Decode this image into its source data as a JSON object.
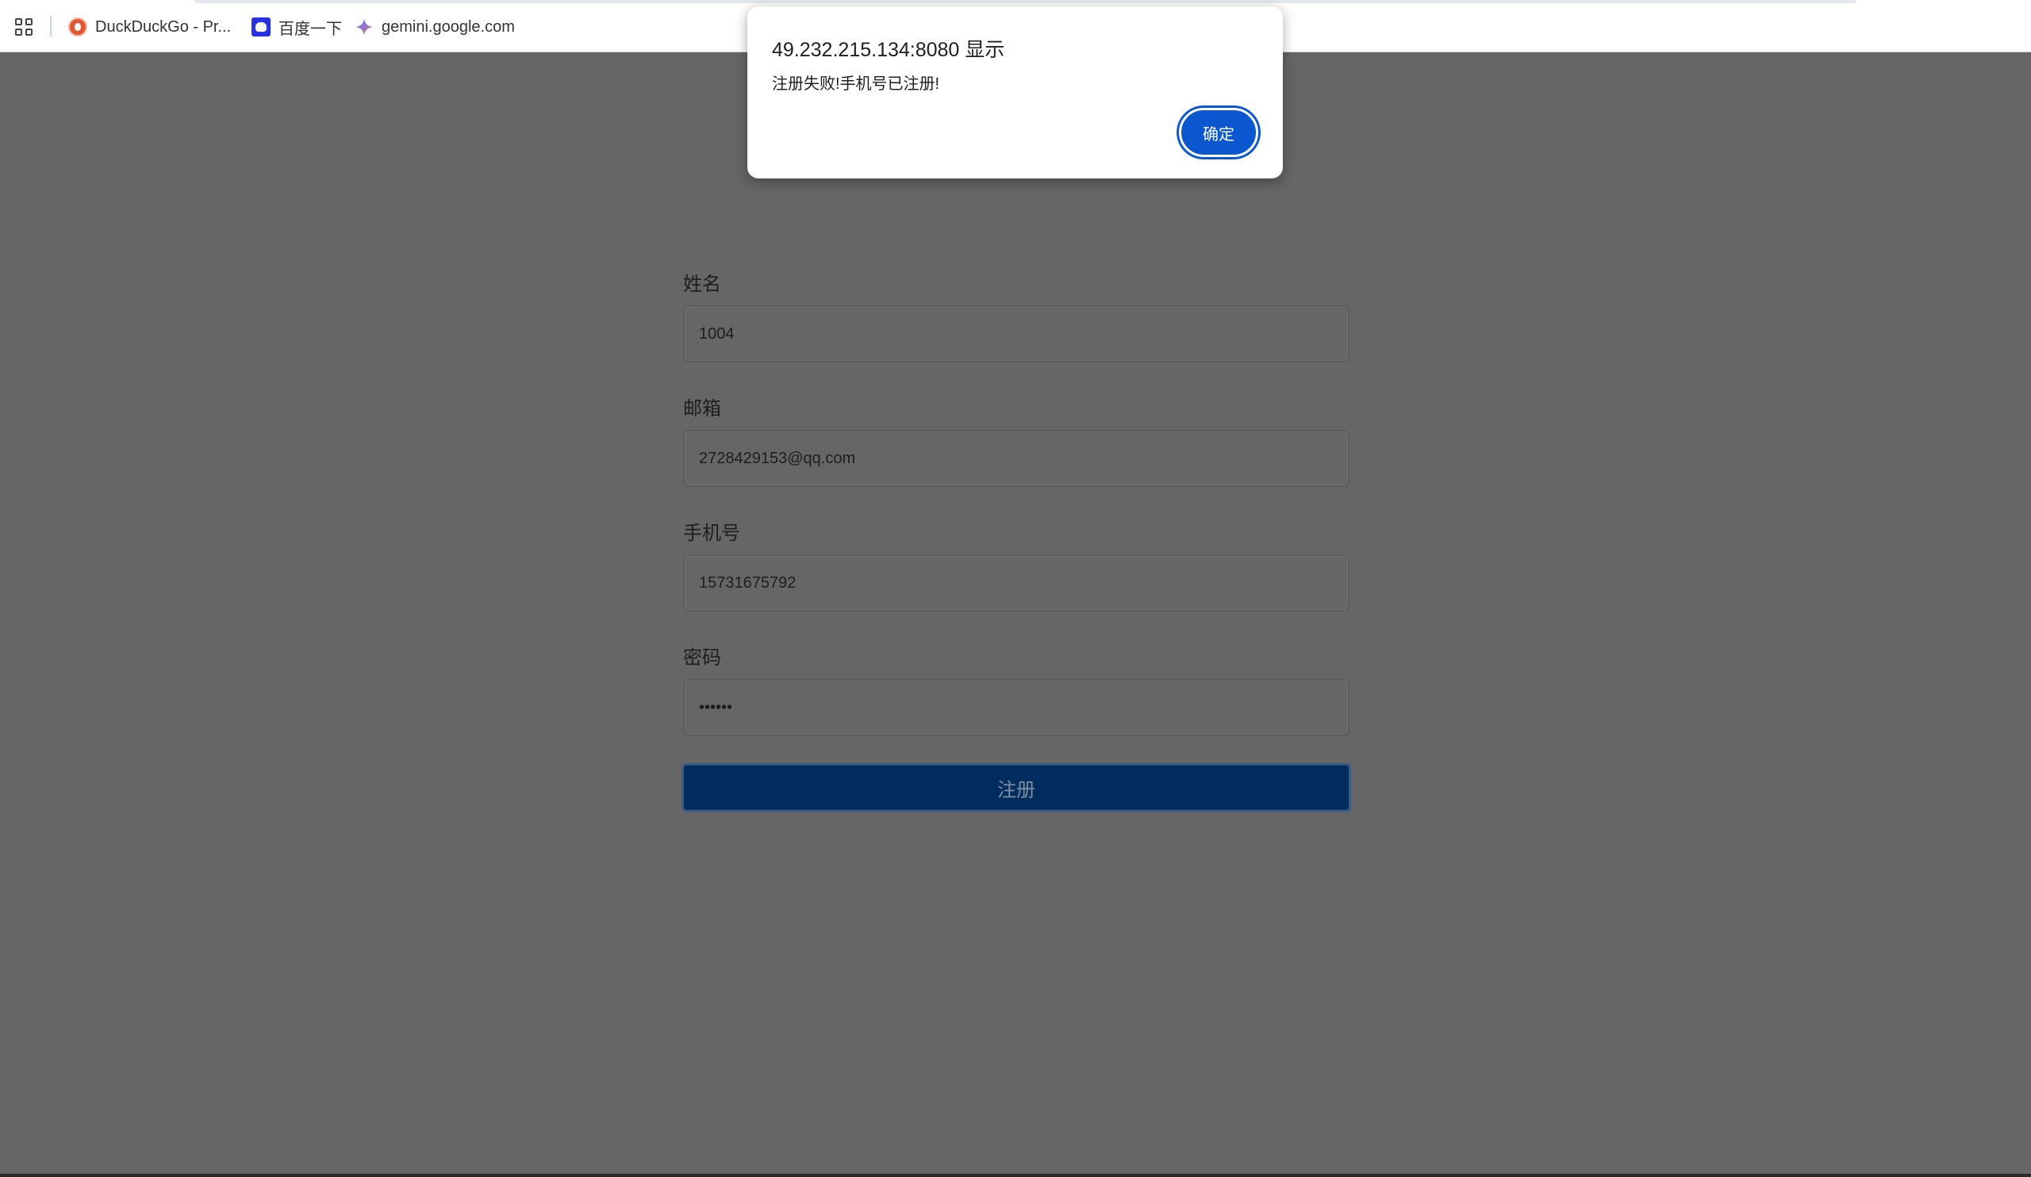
{
  "bookmarks_bar": {
    "items": [
      {
        "label": "DuckDuckGo - Pr...",
        "icon": "duckduckgo-icon"
      },
      {
        "label": "百度一下",
        "icon": "baidu-icon"
      },
      {
        "label": "gemini.google.com",
        "icon": "gemini-icon"
      }
    ]
  },
  "page": {
    "title": "",
    "fields": [
      {
        "label": "姓名",
        "value": "1004"
      },
      {
        "label": "邮箱",
        "value": "2728429153@qq.com"
      },
      {
        "label": "手机号",
        "value": "15731675792"
      },
      {
        "label": "密码",
        "value": "••••••"
      }
    ],
    "submit_label": "注册"
  },
  "dialog": {
    "title": "49.232.215.134:8080 显示",
    "message": "注册失败!手机号已注册!",
    "ok_label": "确定"
  },
  "colors": {
    "accent": "#0b57d0",
    "submit_bg": "#002c5e",
    "overlay": "#666666"
  }
}
